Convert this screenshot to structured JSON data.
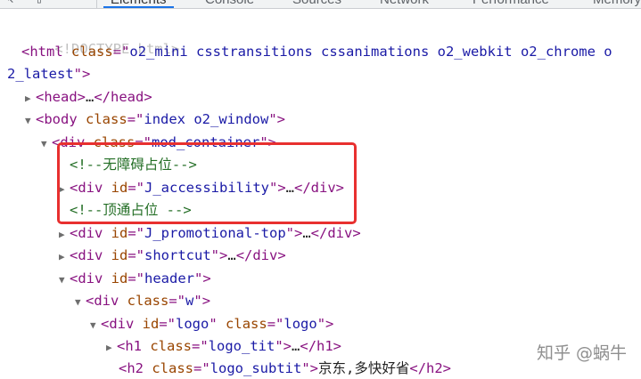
{
  "tabs": [
    "Elements",
    "Console",
    "Sources",
    "Network",
    "Performance",
    "Memory"
  ],
  "icons": [
    "inspect-icon",
    "device-toolbar-icon"
  ],
  "tree": {
    "doctype": "<!DOCTYPE html>",
    "html_open": "<html",
    "html_attr": "class",
    "html_class": "o2_mini csstransitions cssanimations o2_webkit o2_chrome o",
    "html_class_cont": "2_latest",
    "html_close": ">",
    "head": "<head>",
    "head_ell": "…",
    "head_end": "</head>",
    "body_open": "<body",
    "body_attr": "class",
    "body_class": "index o2_window",
    "div_mod": "<div",
    "div_mod_attr": "class",
    "div_mod_val": "mod_container",
    "comment1": "<!--无障碍占位-->",
    "div_acc": "<div",
    "div_acc_attr": "id",
    "div_acc_val": "J_accessibility",
    "div_acc_ell": "…",
    "div_end": "</div>",
    "comment2": "<!--顶通占位 -->",
    "div_promo_val": "J_promotional-top",
    "div_shortcut_val": "shortcut",
    "div_header_val": "header",
    "div_w_val": "w",
    "div_logo_attr1": "id",
    "div_logo_val1": "logo",
    "div_logo_attr2": "class",
    "div_logo_val2": "logo",
    "h1_open": "<h1",
    "h1_attr": "class",
    "h1_val": "logo_tit",
    "h1_end": "</h1>",
    "h2_open": "<h2",
    "h2_attr": "class",
    "h2_val": "logo_subtit",
    "h2_text": "京东,多快好省",
    "h2_end": "</h2>"
  },
  "watermark": "知乎 @蜗牛"
}
